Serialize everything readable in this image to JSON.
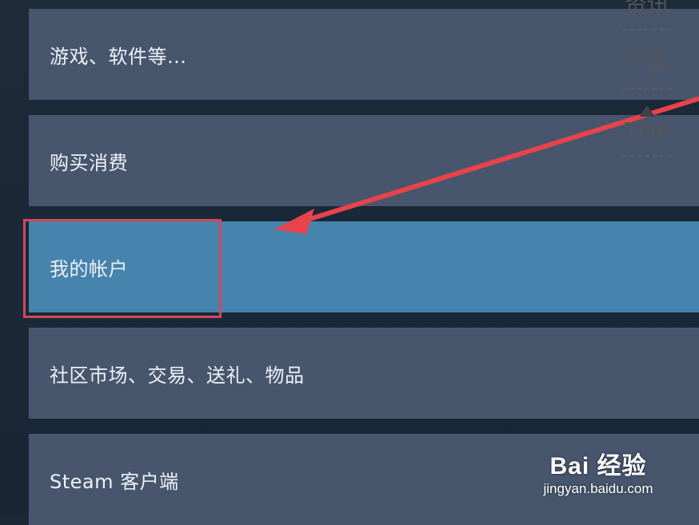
{
  "menu": {
    "items": [
      {
        "label": "游戏、软件等..."
      },
      {
        "label": "购买消费"
      },
      {
        "label": "我的帐户"
      },
      {
        "label": "社区市场、交易、送礼、物品"
      },
      {
        "label": "Steam 客户端"
      }
    ],
    "active_index": 2
  },
  "side_nav": {
    "items": [
      {
        "label": "资讯"
      },
      {
        "label": "产品"
      },
      {
        "label": "TOP"
      }
    ]
  },
  "watermark": {
    "logo": "Bai  经验",
    "url": "jingyan.baidu.com"
  },
  "colors": {
    "background": "#1b2838",
    "item": "#47566d",
    "item_active": "#4683ad",
    "text": "#ecf1f6",
    "highlight": "#d4475a",
    "arrow": "#e8434b"
  }
}
